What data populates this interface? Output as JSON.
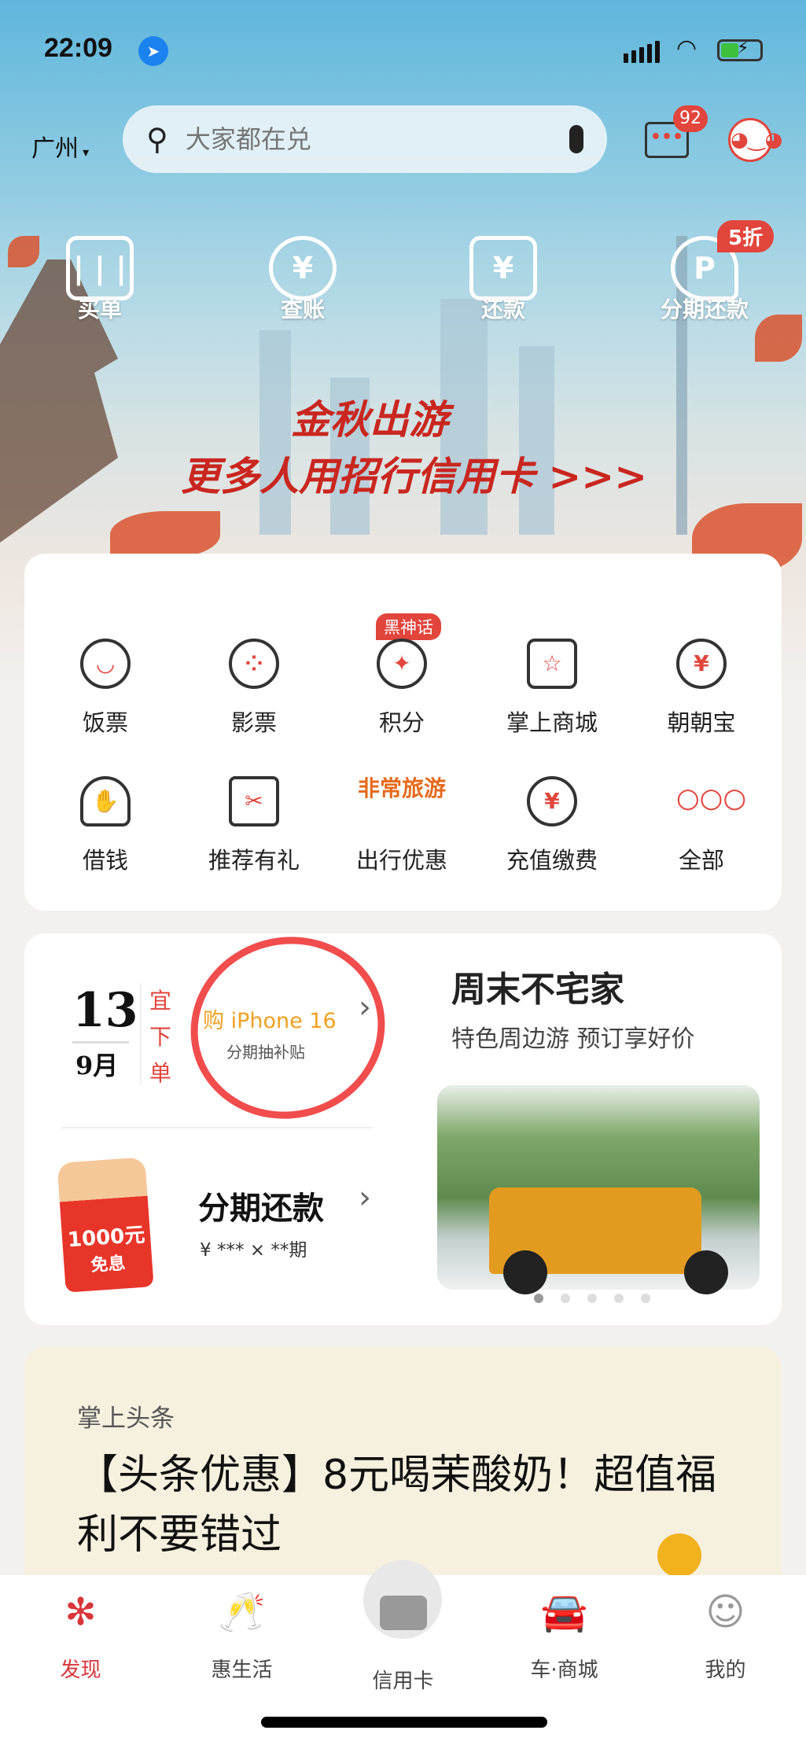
{
  "status_bar": {
    "time": "22:09",
    "location_icon": "location-arrow-icon",
    "battery": "charging"
  },
  "header": {
    "city": "广州",
    "city_dropdown_icon": "caret-down-icon",
    "search_placeholder": "大家都在兑",
    "message_badge": "92",
    "colors": {
      "brand": "#e2453c"
    }
  },
  "quick_actions": [
    {
      "label": "买单",
      "icon": "scan-icon"
    },
    {
      "label": "查账",
      "icon": "yuan-search-icon"
    },
    {
      "label": "还款",
      "icon": "yuan-transfer-icon"
    },
    {
      "label": "分期还款",
      "icon": "installment-icon",
      "badge": "5折"
    }
  ],
  "banner": {
    "line1": "金秋出游",
    "line2": "更多人用招行信用卡 >>>"
  },
  "grid": {
    "items": [
      {
        "label": "饭票",
        "icon": "rice-bowl-icon"
      },
      {
        "label": "影票",
        "icon": "film-reel-icon"
      },
      {
        "label": "积分",
        "icon": "points-icon",
        "badge": "黑神话"
      },
      {
        "label": "掌上商城",
        "icon": "shopping-bag-icon"
      },
      {
        "label": "朝朝宝",
        "icon": "money-bag-icon"
      },
      {
        "label": "借钱",
        "icon": "hand-money-icon"
      },
      {
        "label": "推荐有礼",
        "icon": "gift-icon"
      },
      {
        "label": "出行优惠",
        "icon": "travel-logo",
        "logo_text": "非常旅游"
      },
      {
        "label": "充值缴费",
        "icon": "yuan-plus-icon"
      },
      {
        "label": "全部",
        "icon": "more-dots-icon"
      }
    ]
  },
  "promo": {
    "day": "13",
    "month": "9月",
    "almanac": "宜 下 单",
    "iphone_title": "购 iPhone 16",
    "iphone_sub": "分期抽补贴",
    "redpack_amount": "1000元",
    "redpack_sub": "免息",
    "installment_title": "分期还款",
    "installment_sub": "¥ *** × **期",
    "weekend_title": "周末不宅家",
    "weekend_sub": "特色周边游 预订享好价",
    "carousel_pages": 5,
    "carousel_active": 1
  },
  "news": {
    "label": "掌上头条",
    "title": "【头条优惠】8元喝茉酸奶！超值福利不要错过"
  },
  "tabbar": [
    {
      "label": "发现",
      "icon": "flower-at-icon",
      "active": true
    },
    {
      "label": "惠生活",
      "icon": "cheers-glasses-icon"
    },
    {
      "label": "信用卡",
      "icon": "credit-card-icon"
    },
    {
      "label": "车·商城",
      "icon": "car-icon"
    },
    {
      "label": "我的",
      "icon": "person-icon"
    }
  ]
}
